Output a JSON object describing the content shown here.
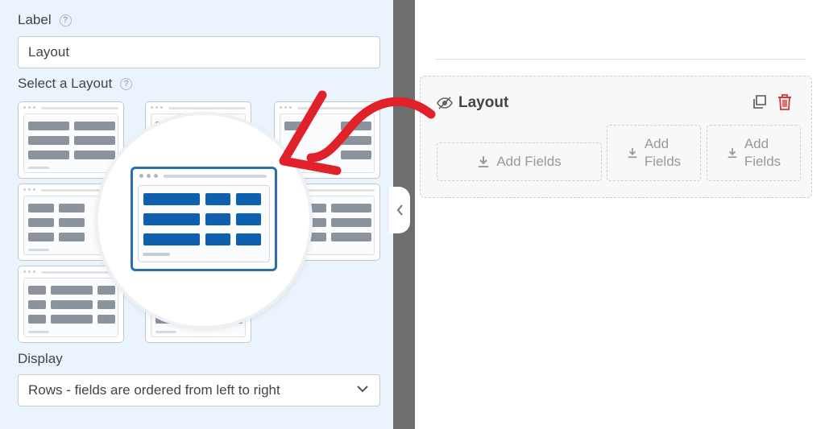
{
  "label_field": {
    "label": "Label",
    "value": "Layout"
  },
  "layout_picker": {
    "label": "Select a Layout",
    "options": [
      {
        "name": "two-columns"
      },
      {
        "name": "three-columns-narrow-left"
      },
      {
        "name": "three-columns-narrow-right"
      },
      {
        "name": "three-equal-columns"
      },
      {
        "name": "two-wide-two-narrow",
        "selected": true
      },
      {
        "name": "four-columns"
      },
      {
        "name": "narrow-wide-narrow"
      },
      {
        "name": "three-columns-bottom"
      }
    ]
  },
  "display": {
    "label": "Display",
    "value": "Rows - fields are ordered from left to right"
  },
  "preview": {
    "field_title": "Layout",
    "slots": [
      {
        "text": "Add Fields"
      },
      {
        "text": "Add\nFields"
      },
      {
        "text": "Add\nFields"
      }
    ]
  },
  "colors": {
    "panel_bg": "#ebf3fc",
    "selected_accent": "#0e5fae",
    "arrow": "#e0212a",
    "delete_icon": "#d63638"
  },
  "icons": [
    "help-icon",
    "chevron-down-icon",
    "collapse-chevron-icon",
    "hidden-eye-icon",
    "duplicate-icon",
    "trash-icon",
    "download-icon"
  ]
}
